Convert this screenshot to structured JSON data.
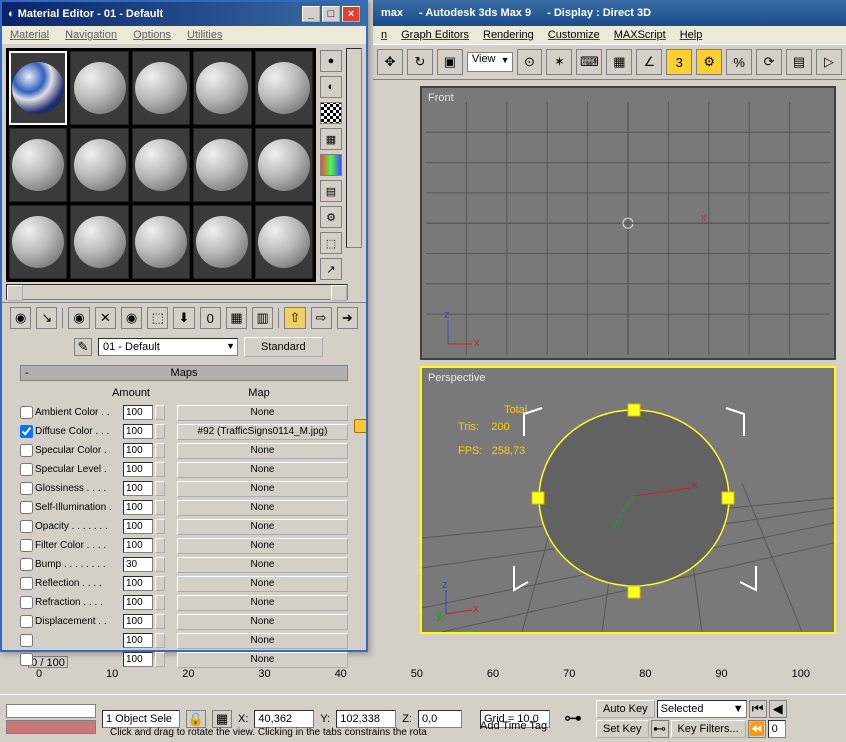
{
  "main": {
    "title_app": "max",
    "title_prod": "- Autodesk 3ds Max 9",
    "title_disp": "- Display : Direct 3D",
    "menu": [
      "n",
      "Graph Editors",
      "Rendering",
      "Customize",
      "MAXScript",
      "Help"
    ],
    "view_dd": "View"
  },
  "viewports": {
    "front": {
      "label": "Front",
      "axis_x": "x",
      "axis_z": "z"
    },
    "persp": {
      "label": "Perspective",
      "stats_total_lbl": "Total",
      "stats_tris_lbl": "Tris:",
      "stats_tris": "200",
      "stats_fps_lbl": "FPS:",
      "stats_fps": "258,73",
      "axis_x": "x",
      "axis_y": "y",
      "axis_z": "z"
    }
  },
  "timeline": {
    "slider": "0 / 100",
    "ticks": [
      "0",
      "10",
      "20",
      "30",
      "40",
      "50",
      "60",
      "70",
      "80",
      "90",
      "100"
    ]
  },
  "status": {
    "sel": "1 Object Sele",
    "x_lbl": "X:",
    "x": "40,362",
    "y_lbl": "Y:",
    "y": "102,338",
    "z_lbl": "Z:",
    "z": "0,0",
    "grid": "Grid = 10,0",
    "autokey": "Auto Key",
    "selected": "Selected",
    "setkey": "Set Key",
    "keyfilters": "Key Filters...",
    "addtag": "Add Time Tag",
    "msg": "Click and drag to rotate the view.  Clicking in the tabs constrains the rota"
  },
  "medit": {
    "title": "Material Editor - 01 - Default",
    "menu": [
      "Material",
      "Navigation",
      "Options",
      "Utilities"
    ],
    "mat_dd": "01 - Default",
    "std_btn": "Standard",
    "rollout": "Maps",
    "col_amount": "Amount",
    "col_map": "Map",
    "maps": [
      {
        "on": false,
        "label": "Ambient Color . .",
        "amount": "100",
        "map": "None"
      },
      {
        "on": true,
        "label": "Diffuse Color . . .",
        "amount": "100",
        "map": "#92 (TrafficSigns0114_M.jpg)"
      },
      {
        "on": false,
        "label": "Specular Color .",
        "amount": "100",
        "map": "None"
      },
      {
        "on": false,
        "label": "Specular Level .",
        "amount": "100",
        "map": "None"
      },
      {
        "on": false,
        "label": "Glossiness . . . .",
        "amount": "100",
        "map": "None"
      },
      {
        "on": false,
        "label": "Self-Illumination .",
        "amount": "100",
        "map": "None"
      },
      {
        "on": false,
        "label": "Opacity . . . . . . .",
        "amount": "100",
        "map": "None"
      },
      {
        "on": false,
        "label": "Filter Color . . . .",
        "amount": "100",
        "map": "None"
      },
      {
        "on": false,
        "label": "Bump . . . . . . . .",
        "amount": "30",
        "map": "None"
      },
      {
        "on": false,
        "label": "Reflection . . . .",
        "amount": "100",
        "map": "None"
      },
      {
        "on": false,
        "label": "Refraction . . . .",
        "amount": "100",
        "map": "None"
      },
      {
        "on": false,
        "label": "Displacement . .",
        "amount": "100",
        "map": "None"
      },
      {
        "on": false,
        "label": "",
        "amount": "100",
        "map": "None"
      },
      {
        "on": false,
        "label": "",
        "amount": "100",
        "map": "None"
      }
    ]
  }
}
